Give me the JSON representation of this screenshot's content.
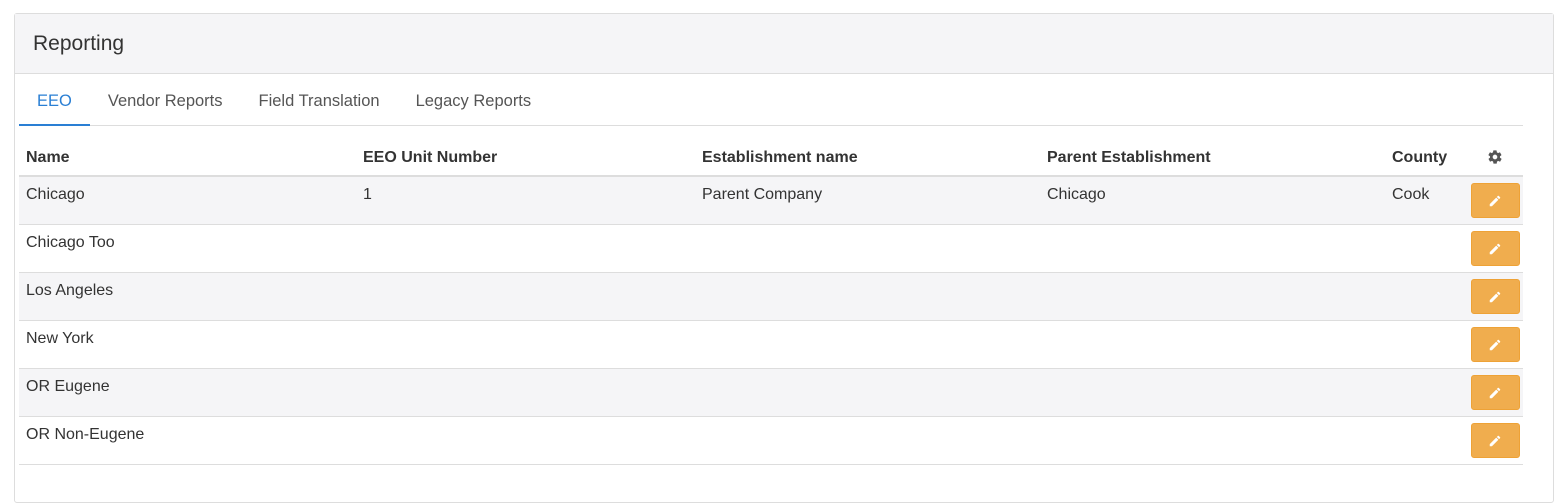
{
  "panel": {
    "title": "Reporting"
  },
  "tabs": [
    {
      "label": "EEO",
      "active": true
    },
    {
      "label": "Vendor Reports",
      "active": false
    },
    {
      "label": "Field Translation",
      "active": false
    },
    {
      "label": "Legacy Reports",
      "active": false
    }
  ],
  "table": {
    "headers": {
      "name": "Name",
      "unit": "EEO Unit Number",
      "establishment": "Establishment name",
      "parent": "Parent Establishment",
      "county": "County",
      "actions_icon": "gear-icon"
    },
    "rows": [
      {
        "name": "Chicago",
        "unit": "1",
        "establishment": "Parent Company",
        "parent": "Chicago",
        "county": "Cook"
      },
      {
        "name": "Chicago Too",
        "unit": "",
        "establishment": "",
        "parent": "",
        "county": ""
      },
      {
        "name": "Los Angeles",
        "unit": "",
        "establishment": "",
        "parent": "",
        "county": ""
      },
      {
        "name": "New York",
        "unit": "",
        "establishment": "",
        "parent": "",
        "county": ""
      },
      {
        "name": "OR Eugene",
        "unit": "",
        "establishment": "",
        "parent": "",
        "county": ""
      },
      {
        "name": "OR Non-Eugene",
        "unit": "",
        "establishment": "",
        "parent": "",
        "county": ""
      }
    ],
    "row_action_icon": "pencil-icon"
  },
  "colors": {
    "accent": "#2a7fd4",
    "edit_button": "#f0ad4e",
    "stripe": "#f5f5f7",
    "border": "#dddddd"
  }
}
